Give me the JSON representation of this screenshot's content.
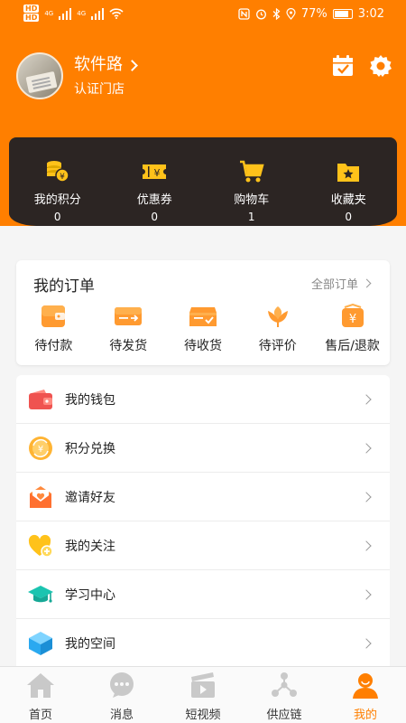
{
  "status_bar": {
    "net_badges": [
      "HD",
      "HD"
    ],
    "net_types": [
      "4G",
      "4G"
    ],
    "battery_percent": "77%",
    "battery_level": 0.77,
    "time": "3:02",
    "icons": [
      "nfc-icon",
      "alarm-icon",
      "bluetooth-icon",
      "location-icon"
    ]
  },
  "profile": {
    "shop_name": "软件路",
    "tag": "认证门店"
  },
  "header_icons": [
    "calendar-check-icon",
    "settings-gear-icon"
  ],
  "stats": [
    {
      "label": "我的积分",
      "value": "0",
      "icon": "coins-icon"
    },
    {
      "label": "优惠券",
      "value": "0",
      "icon": "coupon-icon"
    },
    {
      "label": "购物车",
      "value": "1",
      "icon": "cart-icon"
    },
    {
      "label": "收藏夹",
      "value": "0",
      "icon": "favorites-folder-icon"
    }
  ],
  "orders": {
    "title": "我的订单",
    "all_label": "全部订单",
    "items": [
      {
        "label": "待付款",
        "icon": "wallet-pending-icon"
      },
      {
        "label": "待发货",
        "icon": "ship-pending-icon"
      },
      {
        "label": "待收货",
        "icon": "receive-pending-icon"
      },
      {
        "label": "待评价",
        "icon": "review-pending-icon"
      },
      {
        "label": "售后/退款",
        "icon": "refund-icon"
      }
    ]
  },
  "menu": [
    {
      "label": "我的钱包",
      "icon": "wallet-icon"
    },
    {
      "label": "积分兑换",
      "icon": "points-exchange-icon"
    },
    {
      "label": "邀请好友",
      "icon": "invite-friends-icon"
    },
    {
      "label": "我的关注",
      "icon": "follow-heart-icon"
    },
    {
      "label": "学习中心",
      "icon": "graduation-cap-icon"
    },
    {
      "label": "我的空间",
      "icon": "cube-icon"
    }
  ],
  "bottom_nav": [
    {
      "label": "首页",
      "icon": "home-icon",
      "active": false
    },
    {
      "label": "消息",
      "icon": "message-icon",
      "active": false
    },
    {
      "label": "短视频",
      "icon": "video-icon",
      "active": false
    },
    {
      "label": "供应链",
      "icon": "supply-chain-icon",
      "active": false
    },
    {
      "label": "我的",
      "icon": "profile-icon",
      "active": true
    }
  ],
  "colors": {
    "brand": "#ff7f00",
    "dark_card": "#2c2523",
    "accent_yellow": "#ffc21a"
  }
}
